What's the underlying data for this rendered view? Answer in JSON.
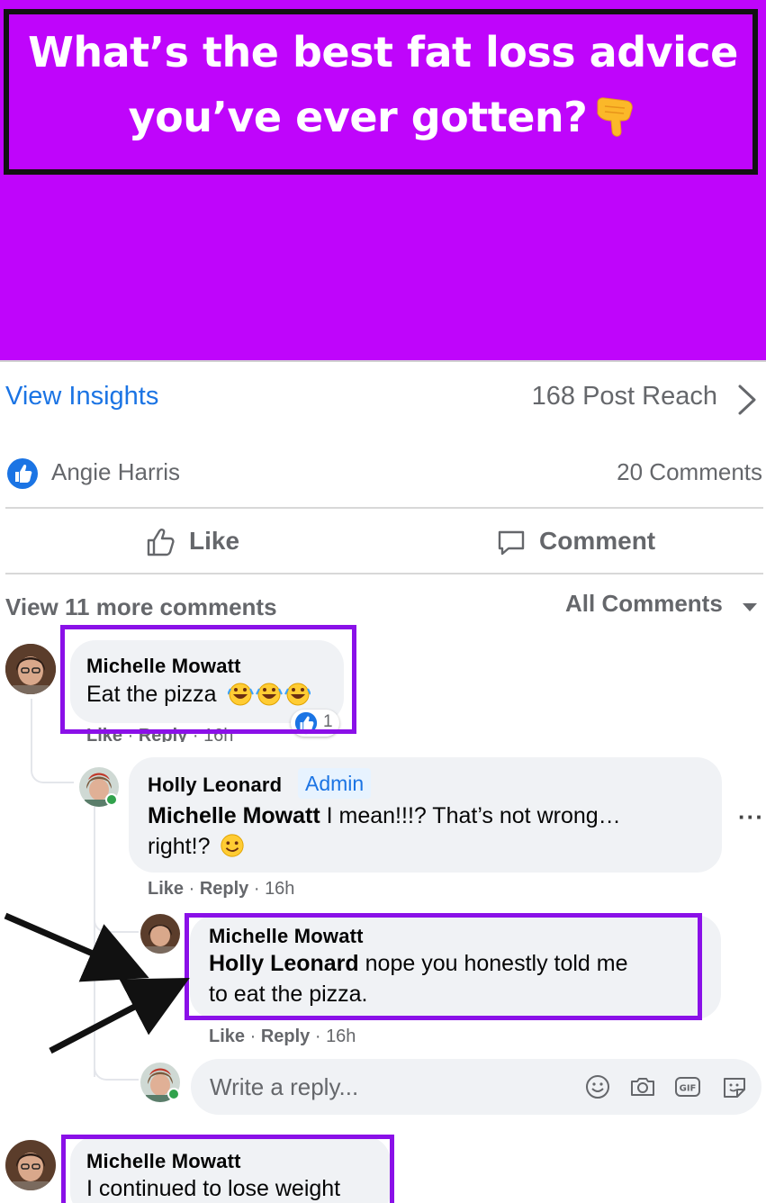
{
  "post": {
    "title_line1": "What’s the best fat loss advice",
    "title_line2": "you’ve ever gotten?",
    "title_emoji": "backhand-index-pointing-down",
    "background_color": "#bf05fb"
  },
  "insights": {
    "link_label": "View Insights",
    "reach_label": "168 Post Reach"
  },
  "reactions": {
    "liker": "Angie Harris",
    "comment_count": "20 Comments"
  },
  "actions": {
    "like": "Like",
    "comment": "Comment"
  },
  "comments_header": {
    "view_more": "View 11 more comments",
    "filter": "All Comments"
  },
  "comments": [
    {
      "author": "Michelle Mowatt",
      "text": "Eat the pizza",
      "emojis": "rolling-on-floor-laughing x3",
      "reaction_count": "1",
      "meta_like": "Like",
      "meta_reply": "Reply",
      "meta_time": "16h"
    },
    {
      "author": "Holly Leonard",
      "badge": "Admin",
      "mention": "Michelle Mowatt",
      "text_line1": " I mean!!!? That’s not wrong…",
      "text_line2": "right!?",
      "emoji": "slightly-smiling-face",
      "meta_like": "Like",
      "meta_reply": "Reply",
      "meta_time": "16h"
    },
    {
      "author": "Michelle Mowatt",
      "mention": "Holly Leonard",
      "text_line1": " nope you honestly told me",
      "text_line2": "to eat the pizza.",
      "meta_like": "Like",
      "meta_reply": "Reply",
      "meta_time": "16h"
    },
    {
      "author": "Michelle Mowatt",
      "text": "I continued to lose weight"
    }
  ],
  "reply_box": {
    "placeholder": "Write a reply..."
  },
  "colors": {
    "accent_blue": "#1b74e4",
    "highlight_purple": "#8a10e8",
    "bubble_gray": "#f0f2f5",
    "online_green": "#31a24c"
  }
}
